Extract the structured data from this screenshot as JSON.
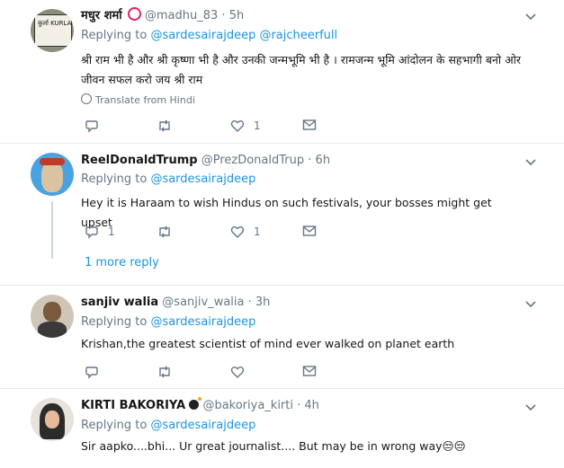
{
  "tweets": [
    {
      "name": "मधुर शर्मा",
      "handle": "@madhu_83",
      "time": "5h",
      "replying_label": "Replying to",
      "replying_to": "@sardesairajdeep @rajcheerfull",
      "text": "श्री राम भी है और श्री कृष्णा भी है और उनकी जन्मभूमि भी है । रामजन्म भूमि आंदोलन के सहभागी बनो ओर जीवन सफल करो जय श्री राम",
      "translate": "Translate from Hindi",
      "avatar_text": "कुर्ला KURLA",
      "likes": "1",
      "replies": "",
      "retweets": ""
    },
    {
      "name": "ReelDonaldTrump",
      "handle": "@PrezDonaldTrup",
      "time": "6h",
      "replying_label": "Replying to",
      "replying_to": "@sardesairajdeep",
      "text": "Hey it is Haraam to wish Hindus on such festivals, your bosses might get upset",
      "likes": "1",
      "replies": "1",
      "retweets": "",
      "more_replies": "1 more reply"
    },
    {
      "name": "sanjiv walia",
      "handle": "@sanjiv_walia",
      "time": "3h",
      "replying_label": "Replying to",
      "replying_to": "@sardesairajdeep",
      "text": "Krishan,the greatest scientist of mind ever walked on planet earth",
      "likes": "",
      "replies": "",
      "retweets": ""
    },
    {
      "name": "KIRTI BAKORIYA",
      "handle": "@bakoriya_kirti",
      "time": "4h",
      "replying_label": "Replying to",
      "replying_to": "@sardesairajdeep",
      "text": "Sir aapko....bhi... Ur great journalist.... But may be in wrong way😒😒",
      "likes": "",
      "replies": "",
      "retweets": ""
    }
  ],
  "separator": "·",
  "colors": {
    "link": "#1b95e0",
    "muted": "#657786",
    "divider": "#e6ecf0",
    "badge_red": "#e0245e"
  }
}
